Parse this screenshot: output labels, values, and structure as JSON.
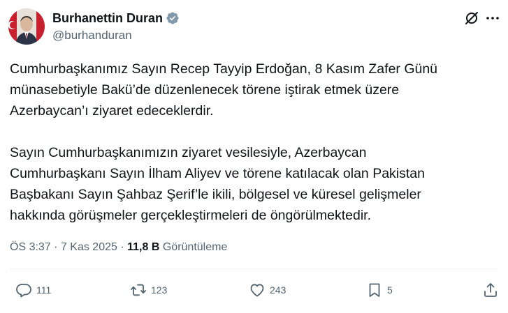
{
  "author": {
    "display_name": "Burhanettin Duran",
    "handle": "@burhanduran",
    "verified_icon": "verified-badge-icon",
    "verified_color": "#829aab"
  },
  "tweet": {
    "paragraphs": [
      {
        "lines": [
          "Cumhurbaşkanımız Sayın Recep Tayyip Erdoğan, 8 Kasım Zafer Günü",
          "münasebetiyle Bakü’de düzenlenecek törene iştirak etmek üzere",
          "Azerbaycan’ı ziyaret edeceklerdir."
        ]
      },
      {
        "lines": [
          "Sayın Cumhurbaşkanımızın ziyaret vesilesiyle, Azerbaycan",
          "Cumhurbaşkanı Sayın İlham Aliyev ve törene katılacak olan Pakistan",
          "Başbakanı Sayın Şahbaz Şerif’le ikili, bölgesel ve küresel gelişmeler",
          "hakkında görüşmeler gerçekleştirmeleri de öngörülmektedir."
        ]
      }
    ]
  },
  "meta": {
    "time": "ÖS 3:37",
    "separator": "·",
    "date": "7 Kas 2025",
    "views_count": "11,8 B",
    "views_label": "Görüntüleme"
  },
  "actions": {
    "replies": "111",
    "retweets": "123",
    "likes": "243",
    "bookmarks": "5"
  },
  "colors": {
    "text_primary": "#0f1419",
    "text_secondary": "#536471",
    "divider": "#eff3f4"
  }
}
